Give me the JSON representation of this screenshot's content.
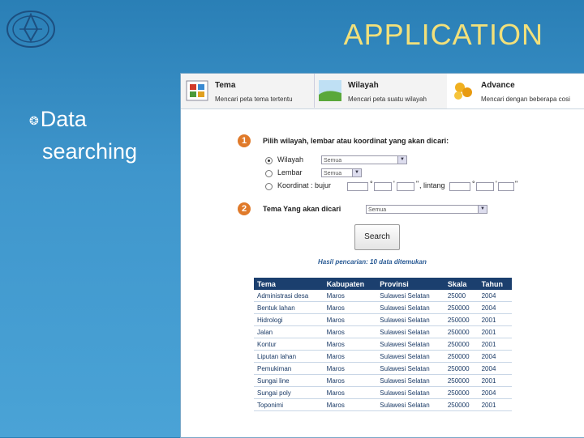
{
  "slide": {
    "title": "APPLICATION",
    "bullet_line1": "Data",
    "bullet_line2": "searching",
    "bullet_glyph": "❂"
  },
  "app": {
    "tabs": [
      {
        "name": "Tema",
        "desc": "Mencari peta tema tertentu",
        "icon": "grid-icon"
      },
      {
        "name": "Wilayah",
        "desc": "Mencari peta suatu wilayah",
        "icon": "landscape-icon"
      },
      {
        "name": "Advance",
        "desc": "Mencari dengan beberapa cosi",
        "icon": "coins-icon"
      }
    ],
    "step1": {
      "number": "1",
      "heading": "Pilih wilayah, lembar atau koordinat yang akan dicari:",
      "options": [
        {
          "label": "Wilayah",
          "value": "Semua",
          "selected": true
        },
        {
          "label": "Lembar",
          "value": "Semua",
          "selected": false
        },
        {
          "label": "Koordinat : bujur",
          "selected": false
        }
      ],
      "lintang_label": ", lintang"
    },
    "step2": {
      "number": "2",
      "heading": "Tema Yang akan dicari",
      "value": "Semua"
    },
    "search_button": "Search",
    "result_text": "Hasil pencarian: 10 data ditemukan",
    "table": {
      "headers": [
        "Tema",
        "Kabupaten",
        "Provinsi",
        "Skala",
        "Tahun"
      ],
      "rows": [
        [
          "Administrasi desa",
          "Maros",
          "Sulawesi Selatan",
          "25000",
          "2004"
        ],
        [
          "Bentuk lahan",
          "Maros",
          "Sulawesi Selatan",
          "250000",
          "2004"
        ],
        [
          "Hidrologi",
          "Maros",
          "Sulawesi Selatan",
          "250000",
          "2001"
        ],
        [
          "Jalan",
          "Maros",
          "Sulawesi Selatan",
          "250000",
          "2001"
        ],
        [
          "Kontur",
          "Maros",
          "Sulawesi Selatan",
          "250000",
          "2001"
        ],
        [
          "Liputan lahan",
          "Maros",
          "Sulawesi Selatan",
          "250000",
          "2004"
        ],
        [
          "Pemukiman",
          "Maros",
          "Sulawesi Selatan",
          "250000",
          "2004"
        ],
        [
          "Sungai line",
          "Maros",
          "Sulawesi Selatan",
          "250000",
          "2001"
        ],
        [
          "Sungai poly",
          "Maros",
          "Sulawesi Selatan",
          "250000",
          "2004"
        ],
        [
          "Toponimi",
          "Maros",
          "Sulawesi Selatan",
          "250000",
          "2001"
        ]
      ]
    }
  },
  "colors": {
    "accent": "#1b3f6e",
    "title": "#f2e07a",
    "step": "#e07a2a"
  }
}
